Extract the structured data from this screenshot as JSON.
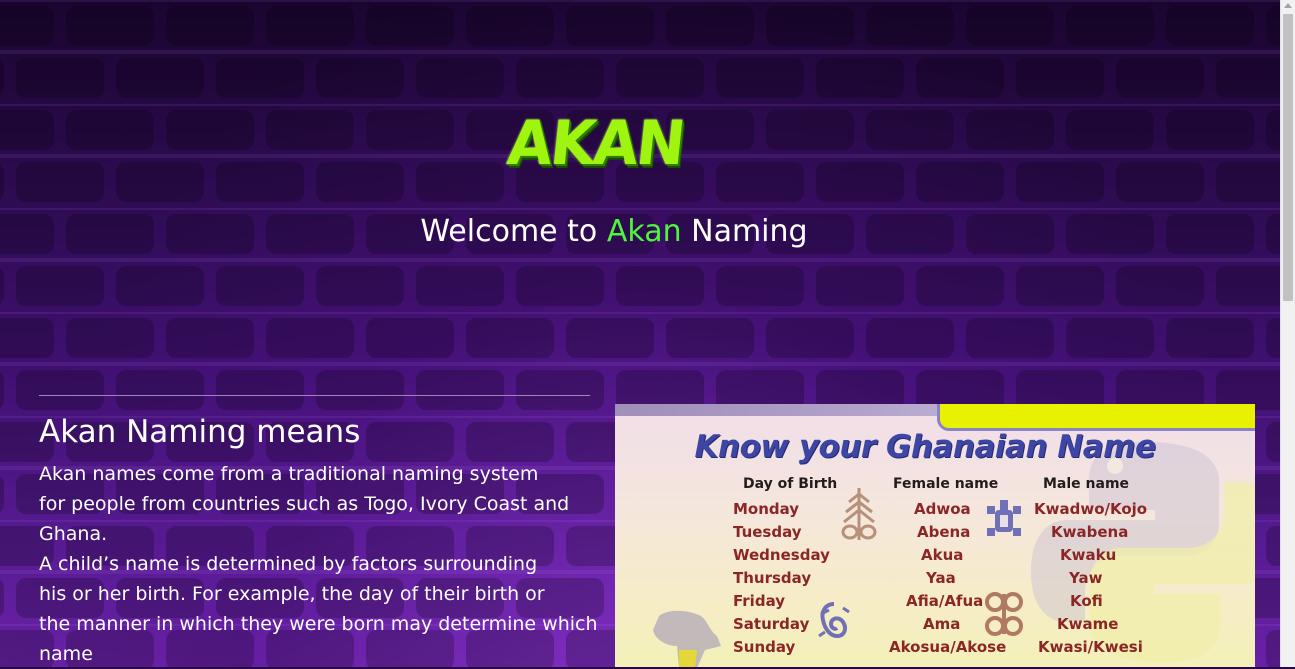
{
  "header": {
    "logo_text": "AKAN",
    "welcome_prefix": "Welcome to ",
    "welcome_accent": "Akan",
    "welcome_suffix": " Naming"
  },
  "about": {
    "title": "Akan Naming means",
    "lines": [
      "Akan names come from a traditional naming system",
      "for people from countries such as Togo, Ivory Coast and",
      "Ghana.",
      "A child’s name is determined by factors surrounding",
      "his or her birth. For example, the day of their birth or",
      "the manner in which they were born may determine which",
      "name"
    ]
  },
  "poster": {
    "title": "Know your Ghanaian Name",
    "headers": {
      "day": "Day of Birth",
      "female": "Female name",
      "male": "Male name"
    },
    "rows": [
      {
        "day": "Monday",
        "female": "Adwoa",
        "male": "Kwadwo/Kojo"
      },
      {
        "day": "Tuesday",
        "female": "Abena",
        "male": "Kwabena"
      },
      {
        "day": "Wednesday",
        "female": "Akua",
        "male": "Kwaku"
      },
      {
        "day": "Thursday",
        "female": "Yaa",
        "male": "Yaw"
      },
      {
        "day": "Friday",
        "female": "Afia/Afua",
        "male": "Kofi"
      },
      {
        "day": "Saturday",
        "female": "Ama",
        "male": "Kwame"
      },
      {
        "day": "Sunday",
        "female": "Akosua/Akose",
        "male": "Kwasi/Kwesi"
      }
    ]
  },
  "colors": {
    "accent_green": "#4ef53a",
    "logo_green": "#9ff50f",
    "poster_title_blue": "#3e46a5",
    "poster_name_red": "#8a2626"
  }
}
